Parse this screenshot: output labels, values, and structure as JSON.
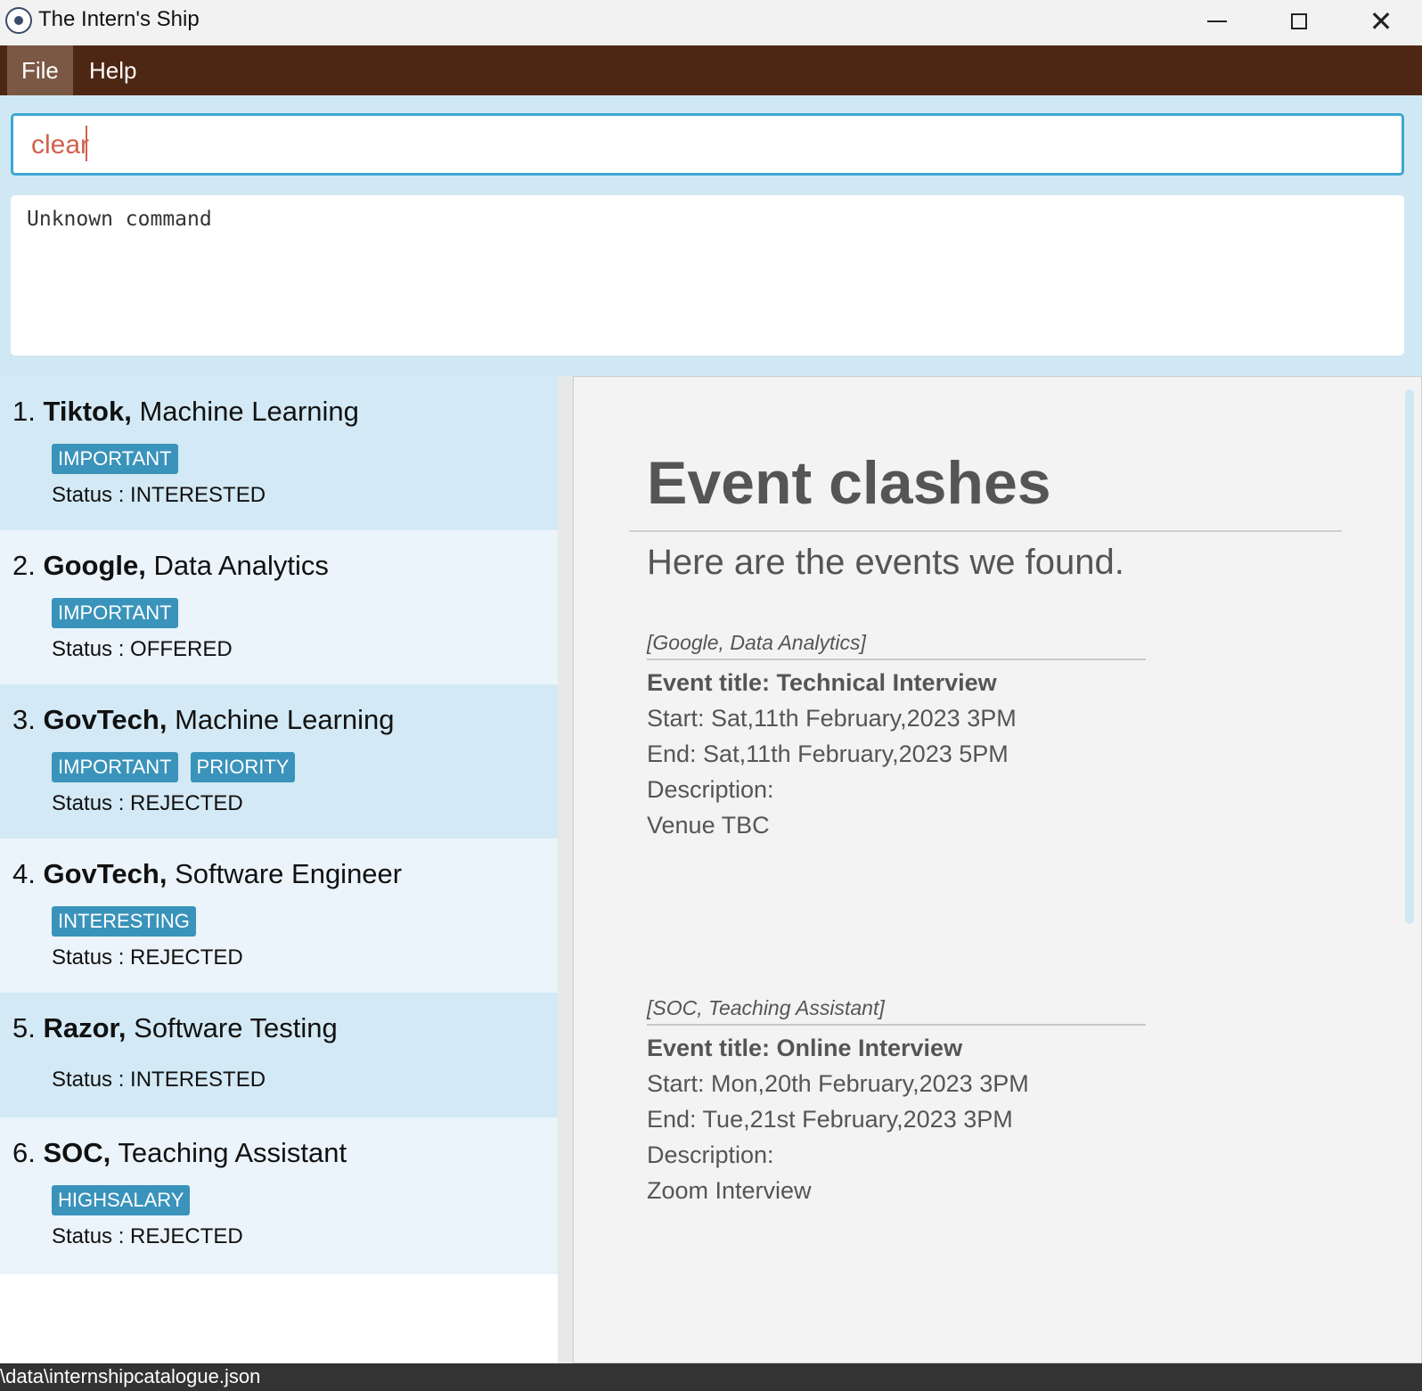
{
  "window": {
    "title": "The Intern's Ship"
  },
  "menu": {
    "file": "File",
    "help": "Help"
  },
  "command": {
    "value": "clear"
  },
  "result": {
    "text": "Unknown command"
  },
  "internships": [
    {
      "index": "1.",
      "company": "Tiktok,",
      "role": "Machine Learning",
      "tags": [
        "IMPORTANT"
      ],
      "status": "Status : INTERESTED"
    },
    {
      "index": "2.",
      "company": "Google,",
      "role": "Data Analytics",
      "tags": [
        "IMPORTANT"
      ],
      "status": "Status : OFFERED"
    },
    {
      "index": "3.",
      "company": "GovTech,",
      "role": "Machine Learning",
      "tags": [
        "IMPORTANT",
        "PRIORITY"
      ],
      "status": "Status : REJECTED"
    },
    {
      "index": "4.",
      "company": "GovTech,",
      "role": "Software Engineer",
      "tags": [
        "INTERESTING"
      ],
      "status": "Status : REJECTED"
    },
    {
      "index": "5.",
      "company": "Razor,",
      "role": "Software Testing",
      "tags": [],
      "status": "Status : INTERESTED"
    },
    {
      "index": "6.",
      "company": "SOC,",
      "role": "Teaching Assistant",
      "tags": [
        "HIGHSALARY"
      ],
      "status": "Status : REJECTED"
    }
  ],
  "detail": {
    "heading": "Event clashes",
    "subheading": "Here are the events we found.",
    "events": [
      {
        "internship": "[Google, Data Analytics]",
        "title": "Event title: Technical Interview",
        "start": "Start: Sat,11th February,2023 3PM",
        "end": "End: Sat,11th February,2023 5PM",
        "description_label": "Description:",
        "description": "Venue TBC"
      },
      {
        "internship": "[SOC, Teaching Assistant]",
        "title": "Event title: Online Interview",
        "start": "Start: Mon,20th February,2023 3PM",
        "end": "End: Tue,21st February,2023 3PM",
        "description_label": "Description:",
        "description": "Zoom Interview"
      }
    ]
  },
  "statusbar": {
    "path": "\\data\\internshipcatalogue.json"
  },
  "colors": {
    "menubar": "#4e2714",
    "tag": "#3a93bb",
    "accent": "#3da7d3",
    "command_text": "#d2614b"
  }
}
